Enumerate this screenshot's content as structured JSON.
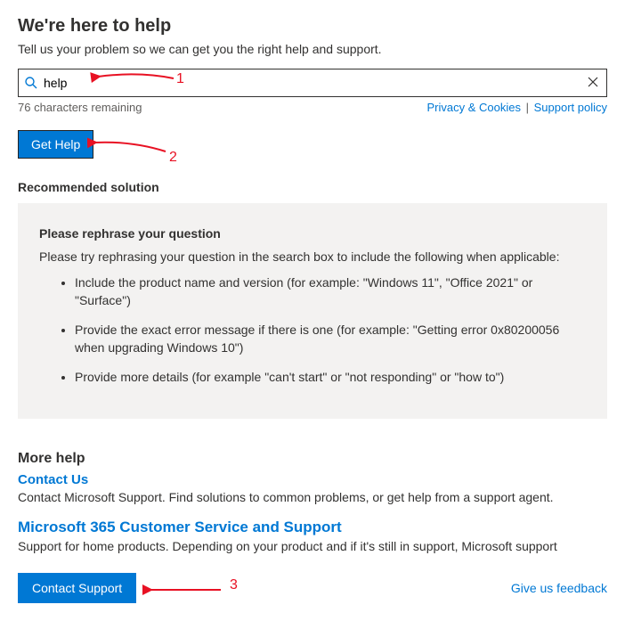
{
  "header": {
    "title": "We're here to help",
    "subtitle": "Tell us your problem so we can get you the right help and support."
  },
  "search": {
    "value": "help",
    "placeholder": "",
    "chars_remaining": "76 characters remaining",
    "privacy_label": "Privacy & Cookies",
    "sep": " | ",
    "policy_label": "Support policy"
  },
  "get_help_label": "Get Help",
  "recommended_heading": "Recommended solution",
  "card": {
    "title": "Please rephrase your question",
    "desc": "Please try rephrasing your question in the search box to include the following when applicable:",
    "bullets": [
      "Include the product name and version (for example: \"Windows 11\", \"Office 2021\" or \"Surface\")",
      "Provide the exact error message if there is one (for example: \"Getting error 0x80200056 when upgrading Windows 10\")",
      "Provide more details (for example \"can't start\" or \"not responding\" or \"how to\")"
    ]
  },
  "more": {
    "heading": "More help",
    "contact_us_label": "Contact Us",
    "contact_us_desc": "Contact Microsoft Support. Find solutions to common problems, or get help from a support agent.",
    "m365_label": "Microsoft 365 Customer Service and Support",
    "m365_desc": "Support for home products. Depending on your product and if it's still in support, Microsoft support"
  },
  "footer": {
    "contact_support_label": "Contact Support",
    "feedback_label": "Give us feedback"
  },
  "annotations": {
    "n1": "1",
    "n2": "2",
    "n3": "3"
  }
}
